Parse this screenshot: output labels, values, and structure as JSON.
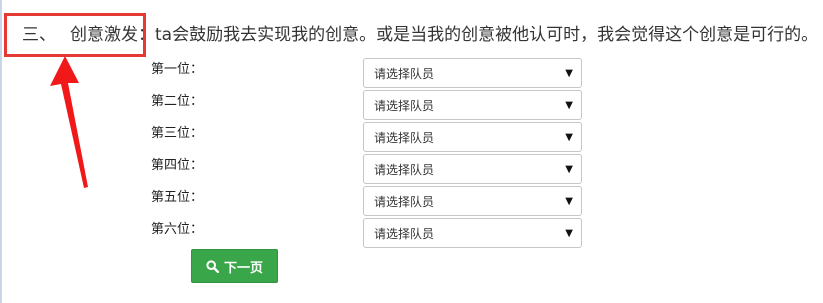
{
  "question": {
    "number": "三、",
    "title": "创意激发：",
    "text": "ta会鼓励我去实现我的创意。或是当我的创意被他认可时，我会觉得这个创意是可行的。"
  },
  "ranking": [
    {
      "label": "第一位：",
      "value": "请选择队员"
    },
    {
      "label": "第二位：",
      "value": "请选择队员"
    },
    {
      "label": "第三位：",
      "value": "请选择队员"
    },
    {
      "label": "第四位：",
      "value": "请选择队员"
    },
    {
      "label": "第五位：",
      "value": "请选择队员"
    },
    {
      "label": "第六位：",
      "value": "请选择队员"
    }
  ],
  "icons": {
    "dropdown": "caret-down-icon",
    "next": "search-icon"
  },
  "next_button": {
    "label": "下一页"
  },
  "colors": {
    "highlight": "#e53935",
    "button": "#3aa64a"
  }
}
